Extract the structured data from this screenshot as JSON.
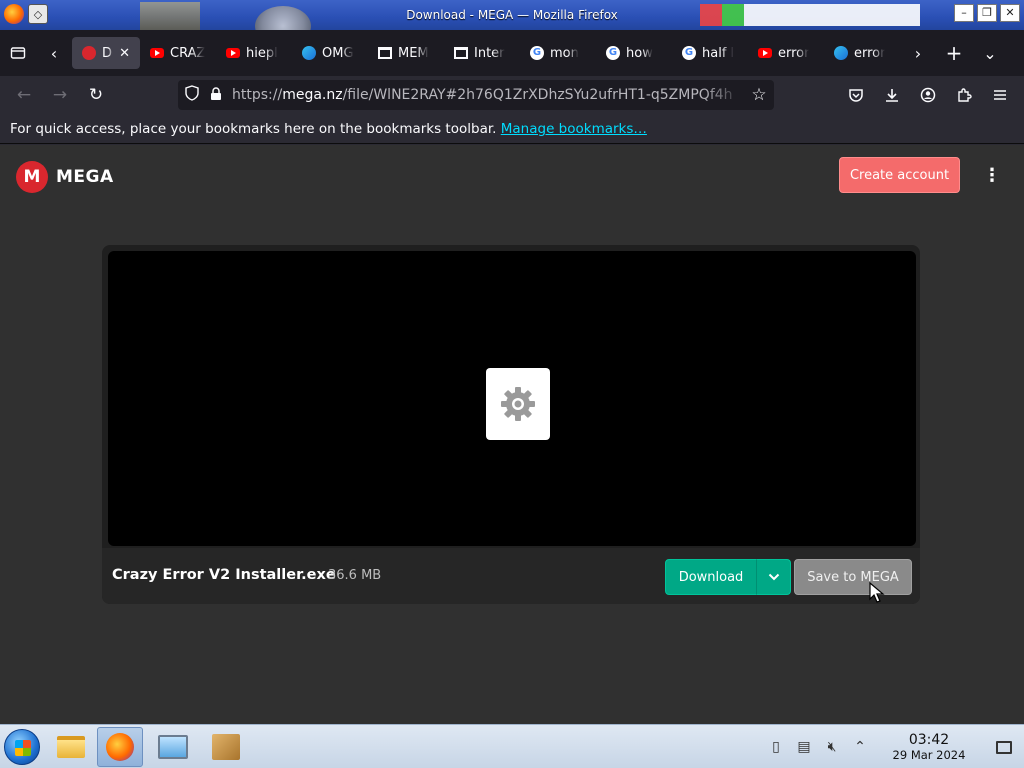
{
  "window": {
    "title": "Download - MEGA — Mozilla Firefox"
  },
  "tabs": [
    {
      "label": "Do",
      "icon": "mega",
      "active": true
    },
    {
      "label": "CRAZ",
      "icon": "youtube"
    },
    {
      "label": "hiepl",
      "icon": "youtube"
    },
    {
      "label": "OMG",
      "icon": "edge"
    },
    {
      "label": "MEM",
      "icon": "archive"
    },
    {
      "label": "Inter",
      "icon": "archive"
    },
    {
      "label": "mon",
      "icon": "google"
    },
    {
      "label": "how",
      "icon": "google"
    },
    {
      "label": "half l",
      "icon": "google"
    },
    {
      "label": "error",
      "icon": "youtube"
    },
    {
      "label": "error",
      "icon": "edge"
    }
  ],
  "urlbar": {
    "protocol": "https://",
    "host": "mega.nz",
    "path": "/file/WlNE2RAY#2h76Q1ZrXDhzSYu2ufrHT1-q5ZMPQf4h"
  },
  "bookmarks_bar": {
    "text": "For quick access, place your bookmarks here on the bookmarks toolbar.",
    "link": "Manage bookmarks…"
  },
  "mega": {
    "logo_mark": "M",
    "logo_text": "MEGA",
    "create_account": "Create account",
    "menu": "⋮"
  },
  "file": {
    "name": "Crazy Error V2 Installer.exe",
    "size": "36.6 MB",
    "download_label": "Download",
    "save_label": "Save to MEGA"
  },
  "taskbar": {
    "time": "03:42",
    "date": "29 Mar 2024"
  },
  "colors": {
    "mega_red": "#d9272e",
    "download_green": "#00a886",
    "create_account_bg": "#f46b6b",
    "page_bg": "#303030"
  }
}
